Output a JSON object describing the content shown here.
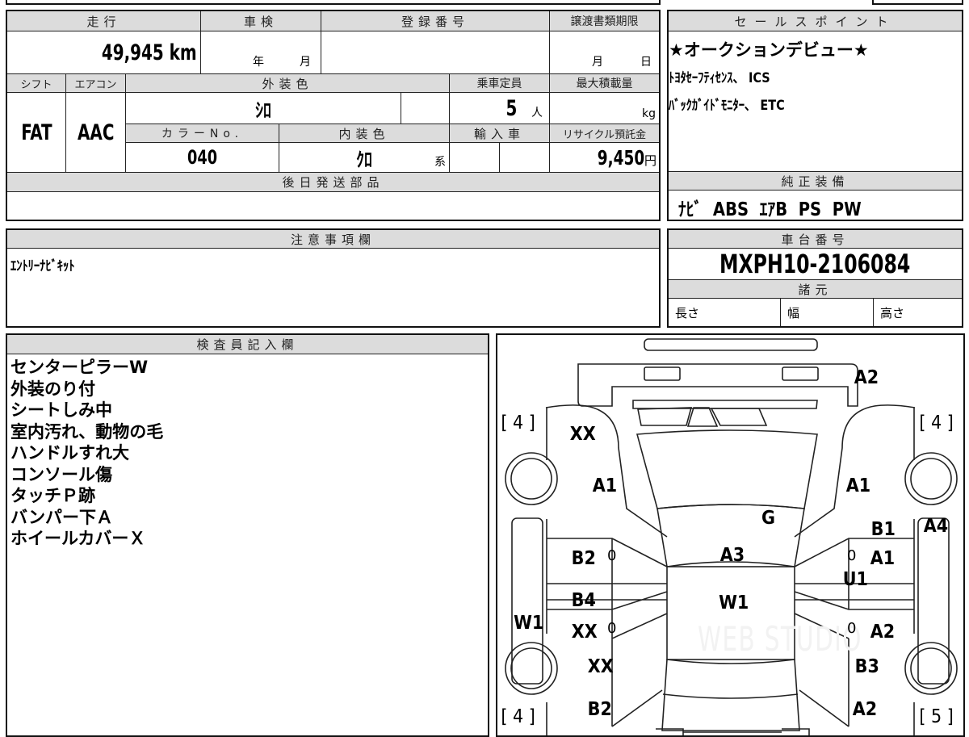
{
  "main_table": {
    "mileage_label": "走行",
    "mileage_value": "49,945",
    "mileage_unit": "km",
    "inspection_label": "車検",
    "inspection_year_unit": "年",
    "inspection_month_unit": "月",
    "registration_label": "登録番号",
    "registration_value": "",
    "transfer_deadline_label": "譲渡書類期限",
    "transfer_month_unit": "月",
    "transfer_day_unit": "日",
    "shift_label": "シフト",
    "shift_value": "FAT",
    "ac_label": "エアコン",
    "ac_value": "AAC",
    "exterior_color_label": "外装色",
    "exterior_color_value": "ｼﾛ",
    "capacity_label": "乗車定員",
    "capacity_value": "5",
    "capacity_unit": "人",
    "max_load_label": "最大積載量",
    "max_load_unit": "kg",
    "color_no_label": "カラーNo.",
    "color_no_value": "040",
    "interior_color_label": "内装色",
    "interior_color_value": "ｸﾛ",
    "interior_color_suffix": "系",
    "import_label": "輸入車",
    "recycle_label": "リサイクル預託金",
    "recycle_value": "9,450",
    "recycle_unit": "円",
    "later_parts_label": "後日発送部品"
  },
  "sales_points": {
    "label": "セールスポイント",
    "lines": [
      "★オークションデビュー★",
      "ﾄﾖﾀｾｰﾌﾃｨｾﾝｽ、 ICS",
      "ﾊﾞｯｸｶﾞｲﾄﾞﾓﾆﾀｰ、 ETC"
    ]
  },
  "standard_equipment": {
    "label": "純正装備",
    "value": "ﾅﾋﾞ  ABS  ｴｱB  PS  PW"
  },
  "notes": {
    "label": "注意事項欄",
    "value": "ｴﾝﾄﾘｰﾅﾋﾞｷｯﾄ"
  },
  "chassis": {
    "label": "車台番号",
    "value": "MXPH10-2106084",
    "specs_label": "諸元",
    "length_label": "長さ",
    "width_label": "幅",
    "height_label": "高さ"
  },
  "inspector": {
    "label": "検査員記入欄",
    "lines": [
      "センターピラーW",
      "外装のり付",
      "シートしみ中",
      "室内汚れ、動物の毛",
      "ハンドルすれ大",
      "コンソール傷",
      "タッチＰ跡",
      "バンパー下Ａ",
      "ホイールカバーＸ"
    ]
  },
  "diagram": {
    "marks": {
      "rear_bumper": "A2",
      "tire_fl": "[ 4 ]",
      "tire_fr": "[ 4 ]",
      "tire_rl": "[ 4 ]",
      "tire_rr": "[ 5 ]",
      "left_front_top": "XX",
      "left_fender_rear": "A1",
      "right_fender_rear": "A1",
      "glass": "G",
      "right_b1": "B1",
      "right_step": "A4",
      "left_rear_door": "B2",
      "roof": "A3",
      "right_rear_door": "A1",
      "right_pillar": "U1",
      "left_front_door_b4": "B4",
      "roof_w1": "W1",
      "left_step": "W1",
      "left_front_door": "XX",
      "right_front_door": "A2",
      "left_front_fender": "XX",
      "right_front_fender": "B3",
      "left_front_bumper": "B2",
      "right_front_bumper": "A2",
      "door_mark": "0"
    },
    "watermark": "WEB STUDIO"
  }
}
